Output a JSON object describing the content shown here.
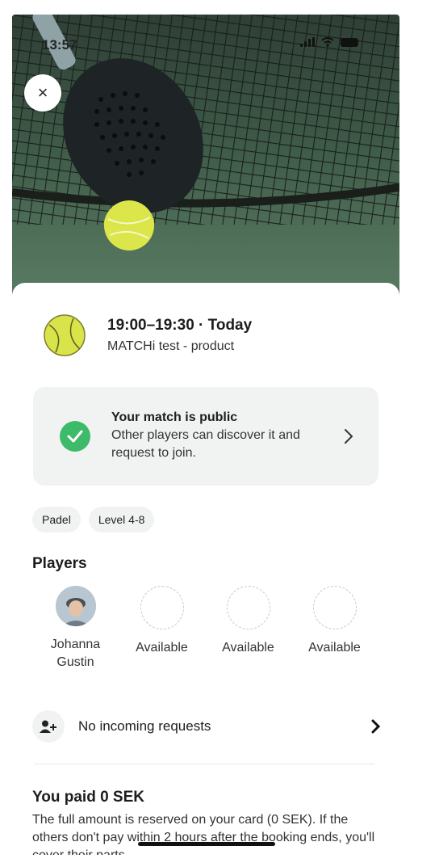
{
  "status_bar": {
    "time": "13:57"
  },
  "hero": {
    "close_icon": "×"
  },
  "booking": {
    "time_range": "19:00–19:30 · Today",
    "venue": "MATCHi test - product"
  },
  "public_card": {
    "title": "Your match is public",
    "description": "Other players can discover it and request to join.",
    "chevron": "›"
  },
  "tags": [
    "Padel",
    "Level 4-8"
  ],
  "players": {
    "title": "Players",
    "items": [
      {
        "name": "Johanna Gustin",
        "has_avatar": true
      },
      {
        "name": "Available",
        "has_avatar": false
      },
      {
        "name": "Available",
        "has_avatar": false
      },
      {
        "name": "Available",
        "has_avatar": false
      }
    ]
  },
  "requests": {
    "label": "No incoming requests",
    "chevron": "›"
  },
  "payment": {
    "title": "You paid 0 SEK",
    "description": "The full amount is reserved on your card (0 SEK). If the others don't pay within 2 hours after the booking ends, you'll cover their parts."
  },
  "colors": {
    "accent_green": "#3dba6a",
    "ball": "#d9e34a",
    "card_bg": "#f1f3f2"
  }
}
